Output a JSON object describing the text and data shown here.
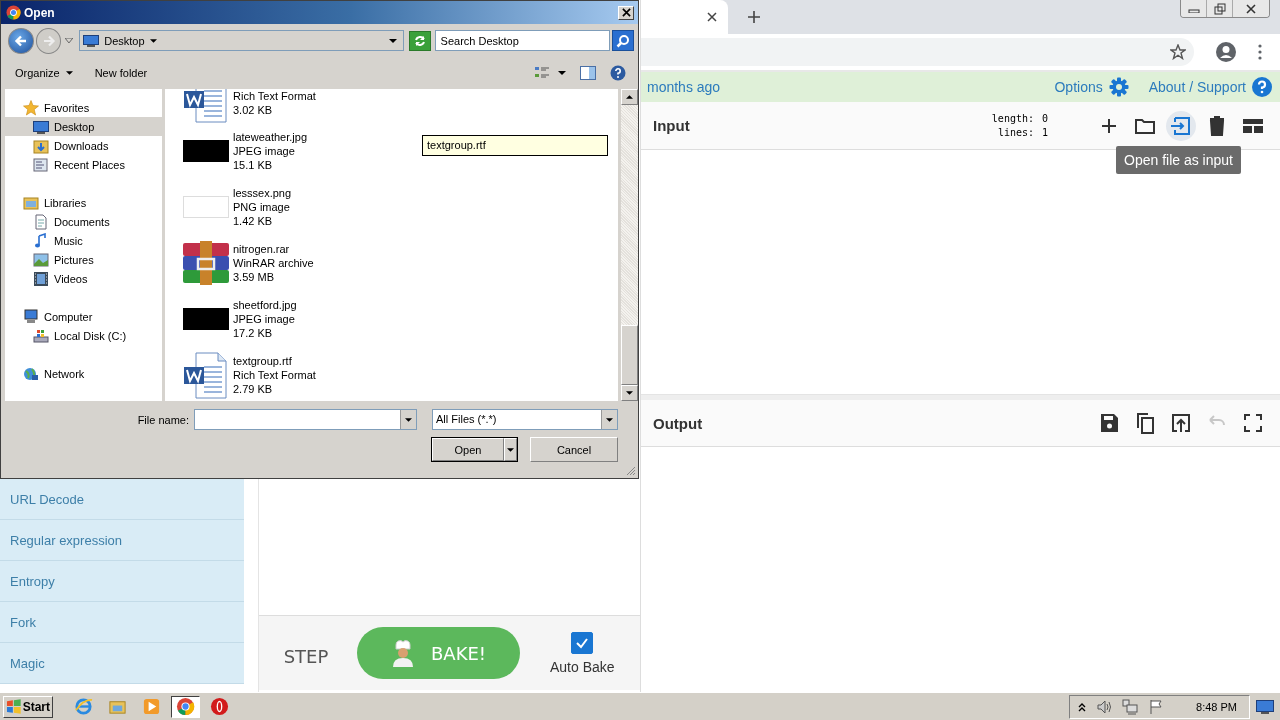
{
  "dialog": {
    "title": "Open",
    "location": "Desktop",
    "search": {
      "placeholder": "Search Desktop"
    },
    "toolbar": [
      "Organize",
      "New folder"
    ],
    "nav": [
      {
        "label": "Favorites",
        "kind": "favorites",
        "selected": false,
        "children": [
          {
            "label": "Desktop",
            "kind": "desktop",
            "selected": true
          },
          {
            "label": "Downloads",
            "kind": "downloads",
            "selected": false
          },
          {
            "label": "Recent Places",
            "kind": "recent",
            "selected": false
          }
        ]
      },
      {
        "label": "Libraries",
        "kind": "libraries",
        "selected": false,
        "children": [
          {
            "label": "Documents",
            "kind": "documents",
            "selected": false
          },
          {
            "label": "Music",
            "kind": "music",
            "selected": false
          },
          {
            "label": "Pictures",
            "kind": "pictures",
            "selected": false
          },
          {
            "label": "Videos",
            "kind": "videos",
            "selected": false
          }
        ]
      },
      {
        "label": "Computer",
        "kind": "computer",
        "selected": false,
        "children": [
          {
            "label": "Local Disk (C:)",
            "kind": "disk",
            "selected": false
          }
        ]
      },
      {
        "label": "Network",
        "kind": "network",
        "selected": false
      }
    ],
    "files": [
      {
        "kind": "rtf",
        "type": "Rich Text Format",
        "size": "3.02 KB"
      },
      {
        "kind": "dark-image",
        "name": "lateweather.jpg",
        "type": "JPEG image",
        "size": "15.1 KB"
      },
      {
        "kind": "light-image",
        "name": "lesssex.png",
        "type": "PNG image",
        "size": "1.42 KB"
      },
      {
        "kind": "archive",
        "name": "nitrogen.rar",
        "type": "WinRAR archive",
        "size": "3.59 MB"
      },
      {
        "kind": "dark-image",
        "name": "sheetford.jpg",
        "type": "JPEG image",
        "size": "17.2 KB"
      },
      {
        "kind": "rtf",
        "name": "textgroup.rtf",
        "type": "Rich Text Format",
        "size": "2.79 KB"
      }
    ],
    "hover_tip": "textgroup.rtf",
    "file_name_label": "File name:",
    "filter": "All Files (*.*)",
    "open": "Open",
    "cancel": "Cancel"
  },
  "operations": [
    "URL Decode",
    "Regular expression",
    "Entropy",
    "Fork",
    "Magic"
  ],
  "recipe": {
    "step": "STEP",
    "bake": "BAKE!",
    "auto_bake": {
      "label": "Auto Bake",
      "checked": true
    }
  },
  "banner": {
    "updated": "months ago",
    "options": "Options",
    "about": "About / Support"
  },
  "input": {
    "title": "Input",
    "stats": [
      {
        "label": "length:",
        "value": "0"
      },
      {
        "label": "lines:",
        "value": "1"
      }
    ],
    "tools": [
      {
        "kind": "add",
        "highlighted": false
      },
      {
        "kind": "folder",
        "highlighted": false
      },
      {
        "kind": "open-file",
        "highlighted": true
      },
      {
        "kind": "trash",
        "highlighted": false
      },
      {
        "kind": "layout",
        "highlighted": false
      }
    ],
    "tooltip": "Open file as input"
  },
  "output": {
    "title": "Output",
    "tools": [
      {
        "kind": "save",
        "disabled": false
      },
      {
        "kind": "copy",
        "disabled": false
      },
      {
        "kind": "move",
        "disabled": false
      },
      {
        "kind": "undo",
        "disabled": true
      },
      {
        "kind": "fullscreen",
        "disabled": false
      }
    ]
  },
  "taskbar": {
    "start": "Start",
    "apps": [
      {
        "kind": "ie",
        "active": false
      },
      {
        "kind": "explorer",
        "active": false
      },
      {
        "kind": "media",
        "active": false
      },
      {
        "kind": "chrome",
        "active": true
      },
      {
        "kind": "opera",
        "active": false
      }
    ],
    "clock": "8:48 PM"
  }
}
